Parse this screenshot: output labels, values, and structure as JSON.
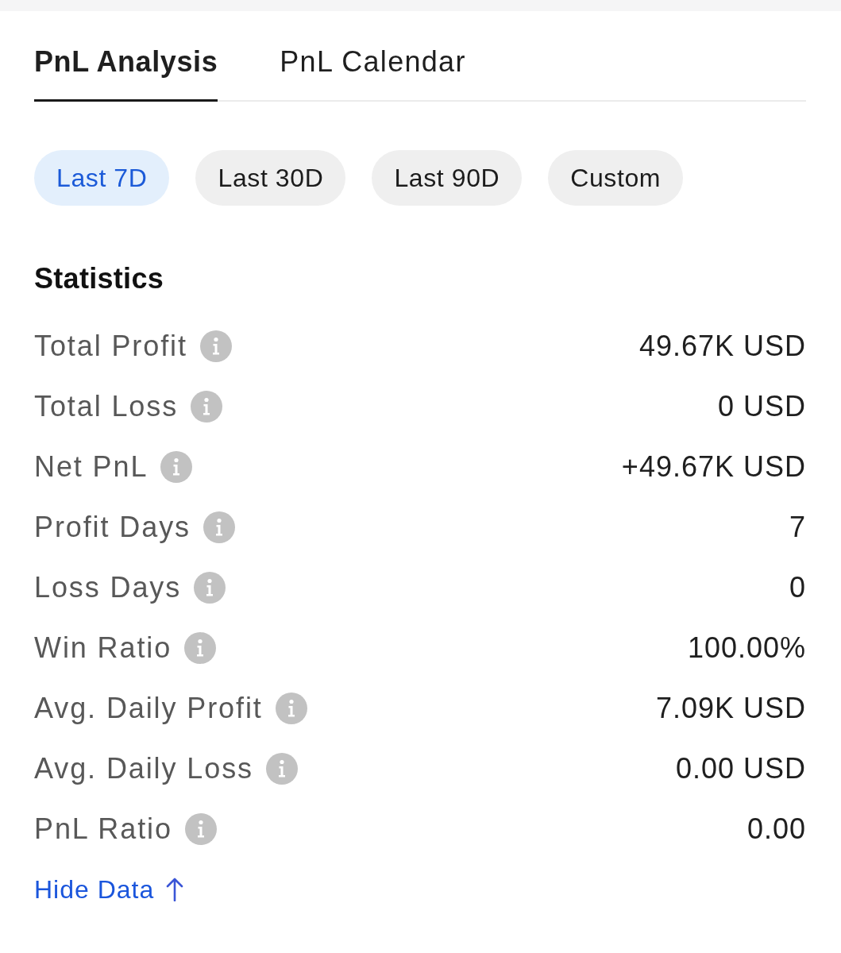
{
  "tabs": [
    {
      "label": "PnL Analysis",
      "selected": true
    },
    {
      "label": "PnL Calendar",
      "selected": false
    }
  ],
  "periods": [
    {
      "label": "Last 7D",
      "selected": true
    },
    {
      "label": "Last 30D",
      "selected": false
    },
    {
      "label": "Last 90D",
      "selected": false
    },
    {
      "label": "Custom",
      "selected": false
    }
  ],
  "statistics": {
    "title": "Statistics",
    "rows": [
      {
        "label": "Total Profit",
        "value": "49.67K USD"
      },
      {
        "label": "Total Loss",
        "value": "0 USD"
      },
      {
        "label": "Net PnL",
        "value": "+49.67K USD"
      },
      {
        "label": "Profit Days",
        "value": "7"
      },
      {
        "label": "Loss Days",
        "value": "0"
      },
      {
        "label": "Win Ratio",
        "value": "100.00%"
      },
      {
        "label": "Avg. Daily Profit",
        "value": "7.09K USD"
      },
      {
        "label": "Avg. Daily Loss",
        "value": "0.00 USD"
      },
      {
        "label": "PnL Ratio",
        "value": "0.00"
      }
    ]
  },
  "hide_data_link": {
    "label": "Hide Data"
  }
}
